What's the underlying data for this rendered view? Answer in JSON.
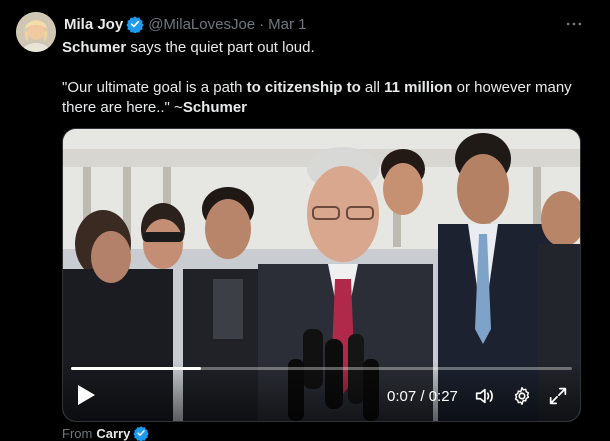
{
  "author": {
    "name": "Mila Joy",
    "handle": "@MilaLovesJoe",
    "separator": "·",
    "date": "Mar 1"
  },
  "tweet": {
    "line1": {
      "bold": "Schumer",
      "rest": " says the quiet part out loud."
    },
    "line2": {
      "p1": "\"Our ultimate goal is a path ",
      "b1": "to citizenship to",
      "p2": " all ",
      "b2": "11 million",
      "p3": " or however many there are here..\" ~",
      "b3": "Schumer"
    }
  },
  "video": {
    "progress": 0.259,
    "time": "0:07 / 0:27"
  },
  "footer": {
    "from_label": "From",
    "source": "Carry"
  },
  "colors": {
    "background": "#000000",
    "text": "#e7e9ea",
    "muted": "#71767b",
    "verified": "#1d9bf0"
  },
  "icons": [
    "verified-badge-icon",
    "more-icon",
    "play-icon",
    "volume-icon",
    "settings-gear-icon",
    "fullscreen-icon"
  ]
}
